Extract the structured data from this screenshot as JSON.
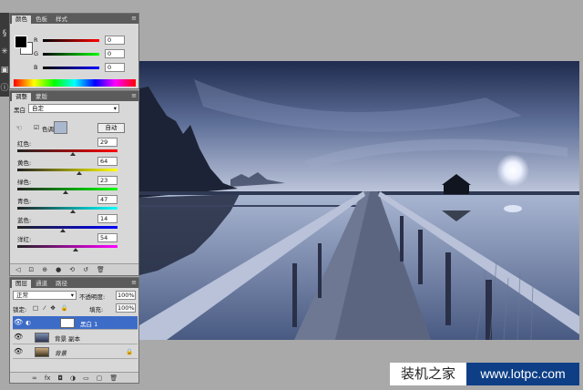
{
  "color_panel": {
    "tabs": [
      "颜色",
      "色板",
      "样式"
    ],
    "channels": [
      {
        "label": "R",
        "value": "0"
      },
      {
        "label": "G",
        "value": "0"
      },
      {
        "label": "B",
        "value": "0"
      }
    ]
  },
  "adjust_panel": {
    "tabs": [
      "调整",
      "蒙版"
    ],
    "title": "黑白",
    "preset": "自定",
    "tint_label": "色调",
    "auto_label": "自动",
    "sliders": [
      {
        "label": "红色:",
        "value": "29",
        "position": 0.55,
        "gradient": "linear-gradient(90deg,#222,#f00)"
      },
      {
        "label": "黄色:",
        "value": "64",
        "position": 0.62,
        "gradient": "linear-gradient(90deg,#222,#ff0)"
      },
      {
        "label": "绿色:",
        "value": "23",
        "position": 0.48,
        "gradient": "linear-gradient(90deg,#222,#0f0)"
      },
      {
        "label": "青色:",
        "value": "47",
        "position": 0.55,
        "gradient": "linear-gradient(90deg,#222,#0ff)"
      },
      {
        "label": "蓝色:",
        "value": "14",
        "position": 0.45,
        "gradient": "linear-gradient(90deg,#222,#00f)"
      },
      {
        "label": "洋红:",
        "value": "54",
        "position": 0.58,
        "gradient": "linear-gradient(90deg,#222,#f0f)"
      }
    ]
  },
  "layers_panel": {
    "tabs": [
      "图层",
      "通道",
      "路径"
    ],
    "blend_mode": "正常",
    "opacity_label": "不透明度:",
    "opacity": "100%",
    "lock_label": "锁定:",
    "fill_label": "填充:",
    "fill": "100%",
    "layers": [
      {
        "name": "黑白 1",
        "selected": true
      },
      {
        "name": "背景 副本",
        "selected": false
      },
      {
        "name": "背景",
        "selected": false
      }
    ]
  },
  "watermark": {
    "brand": "装机之家",
    "url": "www.lotpc.com"
  },
  "colors": {
    "selection": "#3d6cc8",
    "watermark_bg": "#0e3f86"
  }
}
